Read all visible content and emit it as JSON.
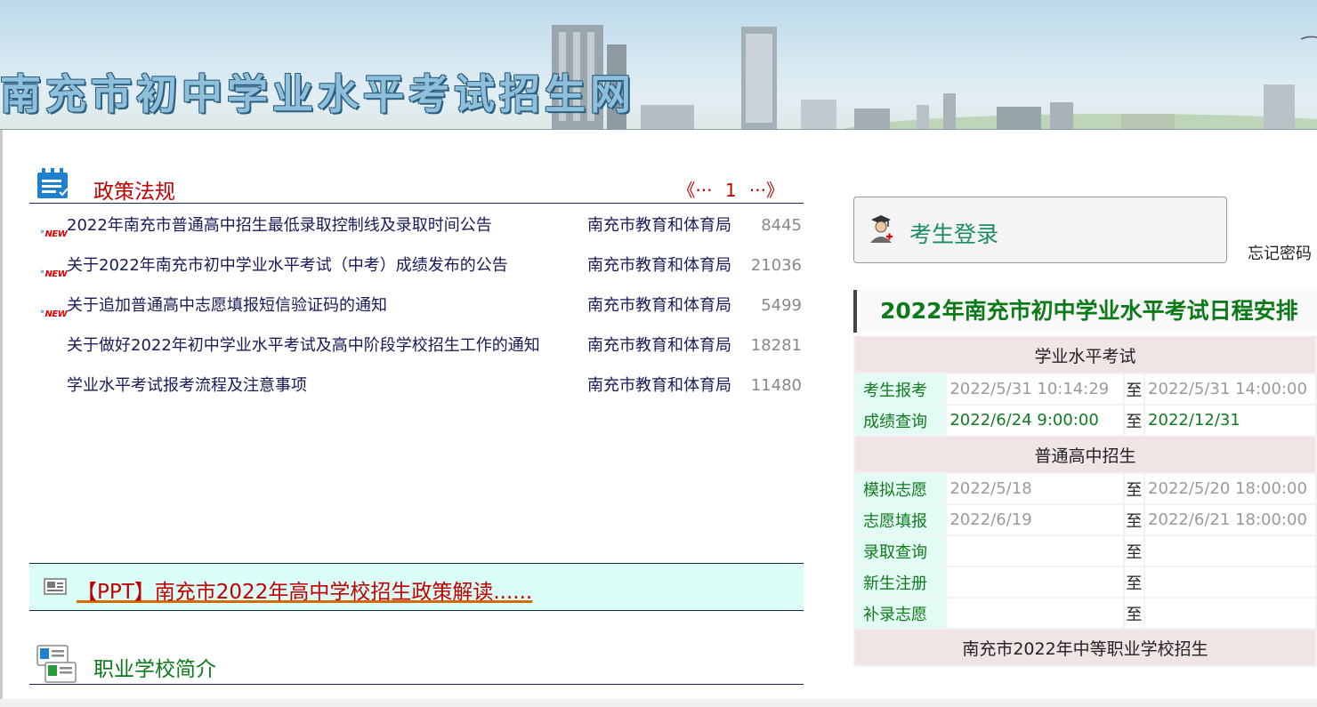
{
  "header": {
    "site_title": "南充市初中学业水平考试招生网"
  },
  "policy": {
    "title": "政策法规",
    "title_color": "#c00000",
    "pager": {
      "prev": "《···",
      "page": "1",
      "next": "···》"
    },
    "items": [
      {
        "is_new": true,
        "new_label": "NEW",
        "title": "2022年南充市普通高中招生最低录取控制线及录取时间公告",
        "source": "南充市教育和体育局",
        "views": "8445"
      },
      {
        "is_new": true,
        "new_label": "NEW",
        "title": "关于2022年南充市初中学业水平考试（中考）成绩发布的公告",
        "source": "南充市教育和体育局",
        "views": "21036"
      },
      {
        "is_new": true,
        "new_label": "NEW",
        "title": "关于追加普通高中志愿填报短信验证码的通知",
        "source": "南充市教育和体育局",
        "views": "5499"
      },
      {
        "is_new": false,
        "new_label": "",
        "title": "关于做好2022年初中学业水平考试及高中阶段学校招生工作的通知",
        "source": "南充市教育和体育局",
        "views": "18281"
      },
      {
        "is_new": false,
        "new_label": "",
        "title": "学业水平考试报考流程及注意事项",
        "source": "南充市教育和体育局",
        "views": "11480"
      }
    ]
  },
  "ppt": {
    "link": "【PPT】南充市2022年高中学校招生政策解读......"
  },
  "vocational": {
    "title": "职业学校简介",
    "title_color": "#0d7a1a"
  },
  "login": {
    "title": "考生登录",
    "forgot": "忘记密码"
  },
  "schedule": {
    "title": "2022年南充市初中学业水平考试日程安排",
    "sep": "至",
    "sections": [
      {
        "name": "学业水平考试",
        "rows": [
          {
            "label": "考生报考",
            "start": "2022/5/31 10:14:29",
            "end": "2022/5/31 14:00:00",
            "state": "past"
          },
          {
            "label": "成绩查询",
            "start": "2022/6/24 9:00:00",
            "end": "2022/12/31",
            "state": "active"
          }
        ]
      },
      {
        "name": "普通高中招生",
        "rows": [
          {
            "label": "模拟志愿",
            "start": "2022/5/18",
            "end": "2022/5/20 18:00:00",
            "state": "past"
          },
          {
            "label": "志愿填报",
            "start": "2022/6/19",
            "end": "2022/6/21 18:00:00",
            "state": "past"
          },
          {
            "label": "录取查询",
            "start": "",
            "end": "",
            "state": "none"
          },
          {
            "label": "新生注册",
            "start": "",
            "end": "",
            "state": "none"
          },
          {
            "label": "补录志愿",
            "start": "",
            "end": "",
            "state": "none"
          }
        ]
      },
      {
        "name": "南充市2022年中等职业学校招生",
        "rows": []
      }
    ]
  }
}
